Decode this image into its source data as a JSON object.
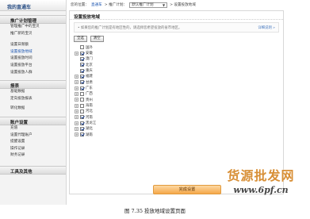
{
  "sidebar": {
    "logo": "我的直通车",
    "sections": [
      {
        "title": "推广计划管理",
        "items": [
          "管理推广中的宝贝",
          "推广新的宝贝",
          "设置日限额",
          "设置投放地域",
          "设置投放时间",
          "设置投放平台",
          "设置投放人群"
        ]
      },
      {
        "title": "报表",
        "items": [
          "基础数据",
          "定向投放报表",
          "转化数据"
        ]
      },
      {
        "title": "账户设置",
        "items": [
          "充值",
          "设置代理账户",
          "提醒设置",
          "操作记录",
          "财务记录"
        ]
      },
      {
        "title": "工具及其他",
        "items": []
      }
    ],
    "active_item": "设置投放地域"
  },
  "topbar": {
    "prefix": "您的位置：",
    "crumb_link": "直通车",
    "sep1": " > 推广计划：",
    "plan_select": "默认推广计划",
    "sep2": " > 设置投放地域"
  },
  "panel": {
    "title": "设置投放地域",
    "notice": "• 如果您的推广计划是有地区性的，请选择您希望投放的省市地区。",
    "notice_link": "详细说明 »",
    "select_all": "全选",
    "clear": "清空",
    "regions": [
      {
        "name": "国外",
        "checked": false,
        "expandable": false
      },
      {
        "name": "安徽",
        "checked": true,
        "expandable": true
      },
      {
        "name": "澳门",
        "checked": true,
        "expandable": false
      },
      {
        "name": "北京",
        "checked": true,
        "expandable": false
      },
      {
        "name": "重庆",
        "checked": true,
        "expandable": false
      },
      {
        "name": "福建",
        "checked": true,
        "expandable": true
      },
      {
        "name": "甘肃",
        "checked": true,
        "expandable": true
      },
      {
        "name": "广东",
        "checked": true,
        "expandable": true
      },
      {
        "name": "广西",
        "checked": false,
        "expandable": true
      },
      {
        "name": "贵州",
        "checked": false,
        "expandable": true
      },
      {
        "name": "海南",
        "checked": false,
        "expandable": true
      },
      {
        "name": "河北",
        "checked": false,
        "expandable": true
      },
      {
        "name": "河南",
        "checked": true,
        "expandable": true
      },
      {
        "name": "黑龙江",
        "checked": true,
        "expandable": true
      },
      {
        "name": "湖北",
        "checked": true,
        "expandable": true
      },
      {
        "name": "湖南",
        "checked": true,
        "expandable": true
      }
    ],
    "done_button": "完成设置"
  },
  "caption": "图 7.35   投放地域设置页面",
  "watermark": {
    "line1": "货源批发网",
    "line2": "www.6pf.cn"
  }
}
